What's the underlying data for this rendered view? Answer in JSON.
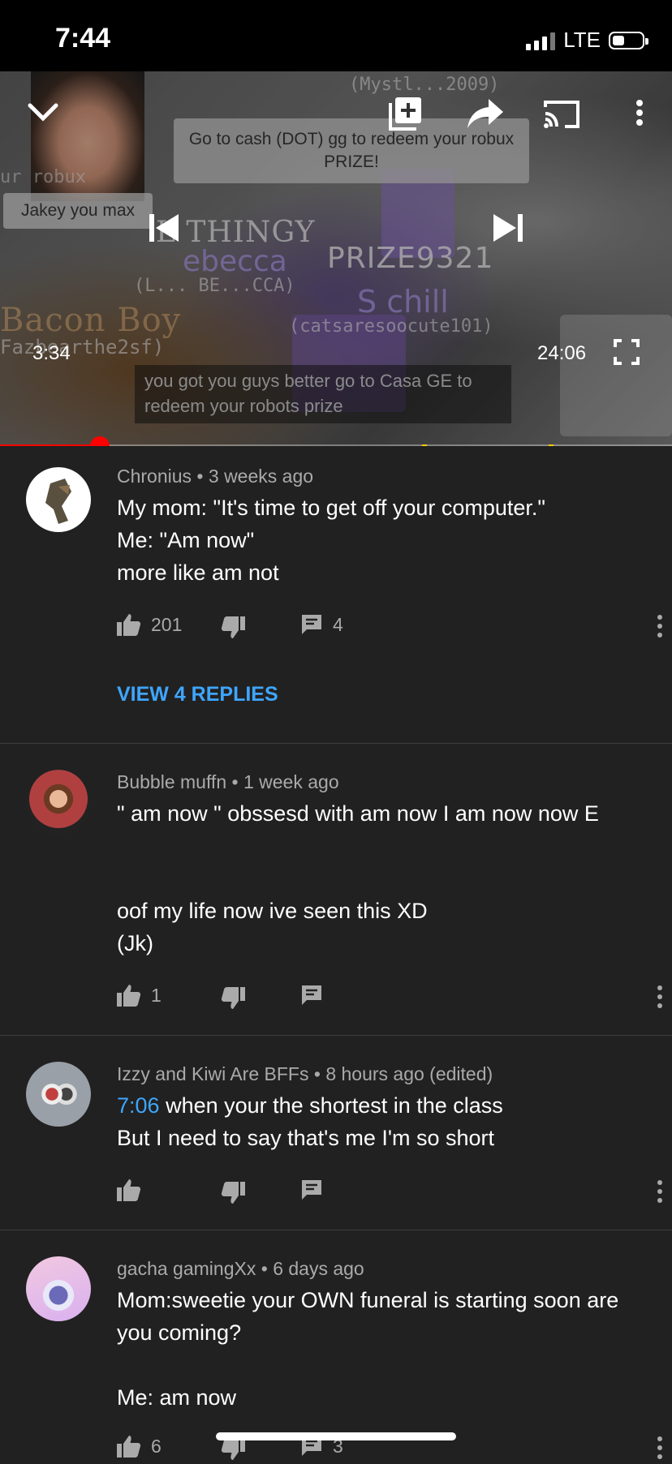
{
  "status_bar": {
    "time": "7:44",
    "network": "LTE"
  },
  "video": {
    "current_time": "3:34",
    "duration": "24:06",
    "progress_fraction": 0.148,
    "overlay_bubble_text": "Go to cash (DOT) gg to redeem your robux PRIZE!",
    "overlay_left_text": "Jakey you max",
    "caption_text": "you got you guys better go to Casa GE to redeem your robots prize",
    "scene_texts": {
      "top_user": "(Mystl...2009)",
      "thingy": "L THINGY",
      "rebecca": "ebecca",
      "rebecca_sub": "(L... BE...CCA)",
      "prize": "PRIZE9321",
      "schill": "S chill",
      "schill_sub": "(catsaresoocute101)",
      "bacon": "Bacon Boy",
      "bacon_sub": "Fazbearthe2sf)",
      "robux": "ur robux"
    }
  },
  "comments": [
    {
      "author": "Chronius",
      "time": "3 weeks ago",
      "lines": [
        "My mom: \"It's time to get off your computer.\"",
        "Me: \"Am now\"",
        "more like am not"
      ],
      "likes": "201",
      "replies": "4",
      "view_replies": "VIEW 4 REPLIES"
    },
    {
      "author": "Bubble muffn",
      "time": "1 week ago",
      "lines": [
        "\" am now \" obssesd with am now I am now now E",
        "",
        "",
        "oof my life now ive seen this XD",
        "(Jk)"
      ],
      "likes": "1",
      "replies": ""
    },
    {
      "author": "Izzy and Kiwi Are BFFs",
      "time": "8 hours ago (edited)",
      "timestamp_link": "7:06",
      "line1_rest": " when your the shortest in the class",
      "line2": "But I need to say that's me I'm so short",
      "likes": "",
      "replies": ""
    },
    {
      "author": "gacha gamingXx",
      "time": "6 days ago",
      "lines": [
        "Mom:sweetie your OWN funeral is starting soon are you coming?",
        "",
        "Me: am now"
      ],
      "likes": "6",
      "replies": "3"
    }
  ],
  "separator": " • ",
  "colors": {
    "accent_blue": "#3ea6ff",
    "progress_red": "#ff0000",
    "background": "#212121"
  }
}
